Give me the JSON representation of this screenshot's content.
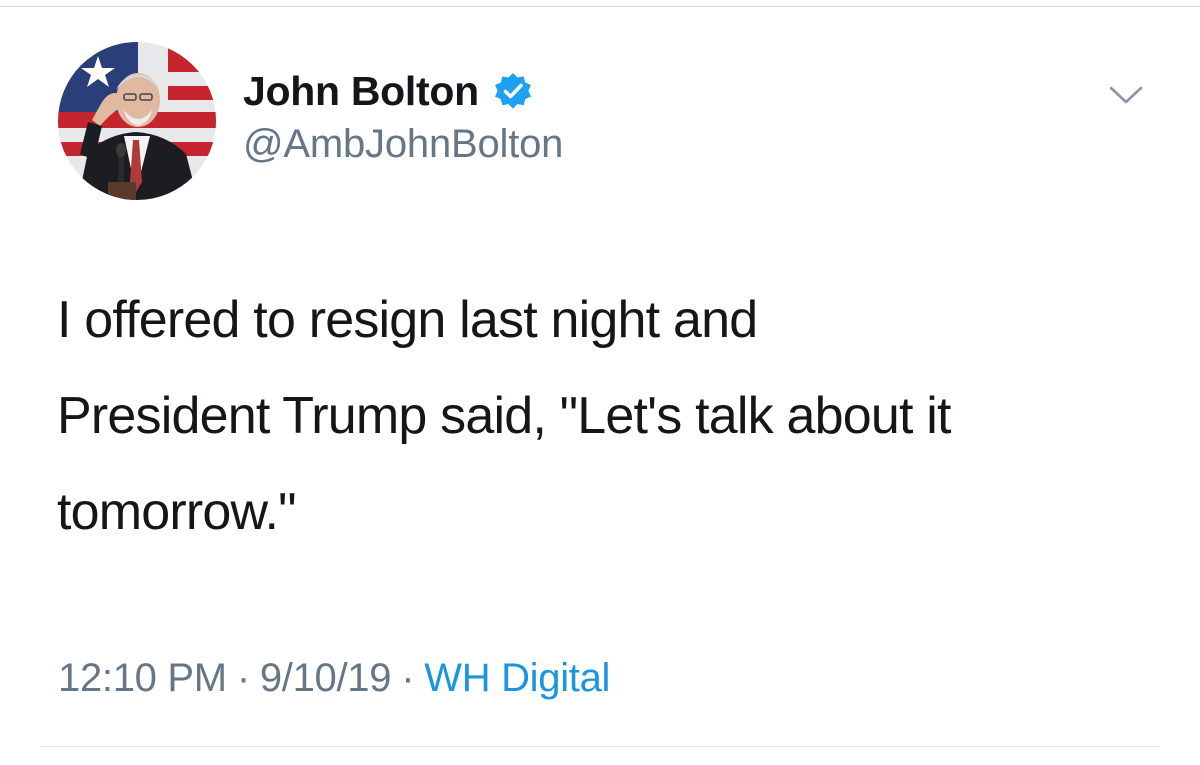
{
  "profile": {
    "display_name": "John Bolton",
    "handle": "@AmbJohnBolton",
    "verified_icon": "verified-badge-icon",
    "avatar_icon": "profile-photo",
    "menu_icon": "chevron-down-icon"
  },
  "tweet": {
    "lines": [
      "I offered to resign last night and",
      "President Trump said, \"Let's talk about it",
      "tomorrow.\""
    ]
  },
  "meta": {
    "time": "12:10 PM",
    "separator": "·",
    "date": "9/10/19",
    "source": "WH Digital"
  },
  "colors": {
    "text": "#14171a",
    "secondary": "#657786",
    "link": "#1b95e0",
    "verified": "#1da1f2"
  }
}
